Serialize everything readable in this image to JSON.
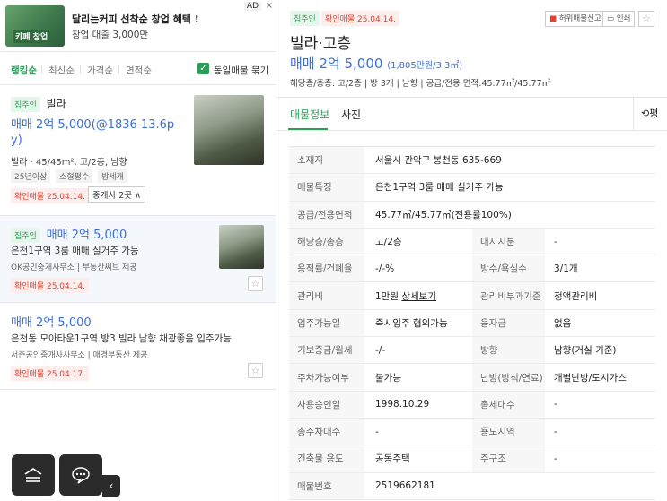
{
  "ad": {
    "badge": "AD",
    "close": "×",
    "title": "달리는커피 선착순 창업 혜택 !",
    "subtitle": "창업 대출 3,000만",
    "thumb_text": "카페 창업"
  },
  "sort": {
    "options": [
      "랭킹순",
      "최신순",
      "가격순",
      "면적순"
    ],
    "same_listing_label": "동일매물 묶기"
  },
  "listing1": {
    "owner_badge": "집주인",
    "type": "빌라",
    "price": "매매 2억 5,000(@1836 13.6p",
    "price_wrap": "y)",
    "summary": "빌라 · 45/45m², 고/2층, 남향",
    "tags": [
      "25년이상",
      "소형평수",
      "방세개"
    ],
    "confirm": "확인매물 25.04.14.",
    "agents": "중개사 2곳",
    "agents_count": "2"
  },
  "sub1": {
    "owner_badge": "집주인",
    "price": "매매 2억 5,000",
    "desc": "은천1구역 3룸 매매 실거주 가능",
    "agency": "OK공인중개사무소",
    "provider": "부동산써브 제공",
    "confirm": "확인매물 25.04.14."
  },
  "listing2": {
    "price": "매매 2억 5,000",
    "desc": "은천동 모아타운1구역 방3 빌라 남향 채광좋음 입주가능",
    "agency": "서준공인중개사사무소",
    "provider": "매경부동산 제공",
    "confirm": "확인매물 25.04.17."
  },
  "detail": {
    "owner_badge": "집주인",
    "confirm_badge": "확인매물 25.04.14.",
    "report_btn": "허위매물신고",
    "print_btn": "인쇄",
    "title": "빌라·고층",
    "price": "매매 2억 5,000",
    "unit_price": "(1,805만원/3.3㎡)",
    "meta": "해당층/총층: 고/2층 | 방 3개 | 남향 | 공급/전용 면적:45.77㎡/45.77㎡",
    "tabs": [
      "매물정보",
      "사진"
    ],
    "tab_extra": "평"
  },
  "info": {
    "address_k": "소재지",
    "address_v": "서울시 관악구 봉천동 635-669",
    "feature_k": "매물특징",
    "feature_v": "은천1구역 3룸 매매 실거주 가능",
    "area_k": "공급/전용면적",
    "area_v": "45.77㎡/45.77㎡(전용률100%)",
    "floor_k": "해당층/총층",
    "floor_v": "고/2층",
    "land_k": "대지지분",
    "land_v": "-",
    "ratio_k": "용적률/건폐율",
    "ratio_v": "-/-%",
    "rooms_k": "방수/욕실수",
    "rooms_v": "3/1개",
    "fee_k": "관리비",
    "fee_v": "1만원",
    "fee_link": "상세보기",
    "fee_basis_k": "관리비부과기준",
    "fee_basis_v": "정액관리비",
    "movein_k": "입주가능일",
    "movein_v": "즉시입주 협의가능",
    "loan_k": "융자금",
    "loan_v": "없음",
    "deposit_k": "기보증금/월세",
    "deposit_v": "-/-",
    "direction_k": "방향",
    "direction_v": "남향(거실 기준)",
    "parking_k": "주차가능여부",
    "parking_v": "불가능",
    "heating_k": "난방(방식/연료)",
    "heating_v": "개별난방/도시가스",
    "approval_k": "사용승인일",
    "approval_v": "1998.10.29",
    "households_k": "총세대수",
    "households_v": "-",
    "totalparking_k": "총주차대수",
    "totalparking_v": "-",
    "zone_k": "용도지역",
    "zone_v": "-",
    "use_k": "건축물 용도",
    "use_v": "공동주택",
    "structure_k": "주구조",
    "structure_v": "-",
    "number_k": "매물번호",
    "number_v": "2519662181"
  },
  "colors": {
    "green": "#2d9e57",
    "blue": "#3a6fd8",
    "red": "#e5412d"
  }
}
